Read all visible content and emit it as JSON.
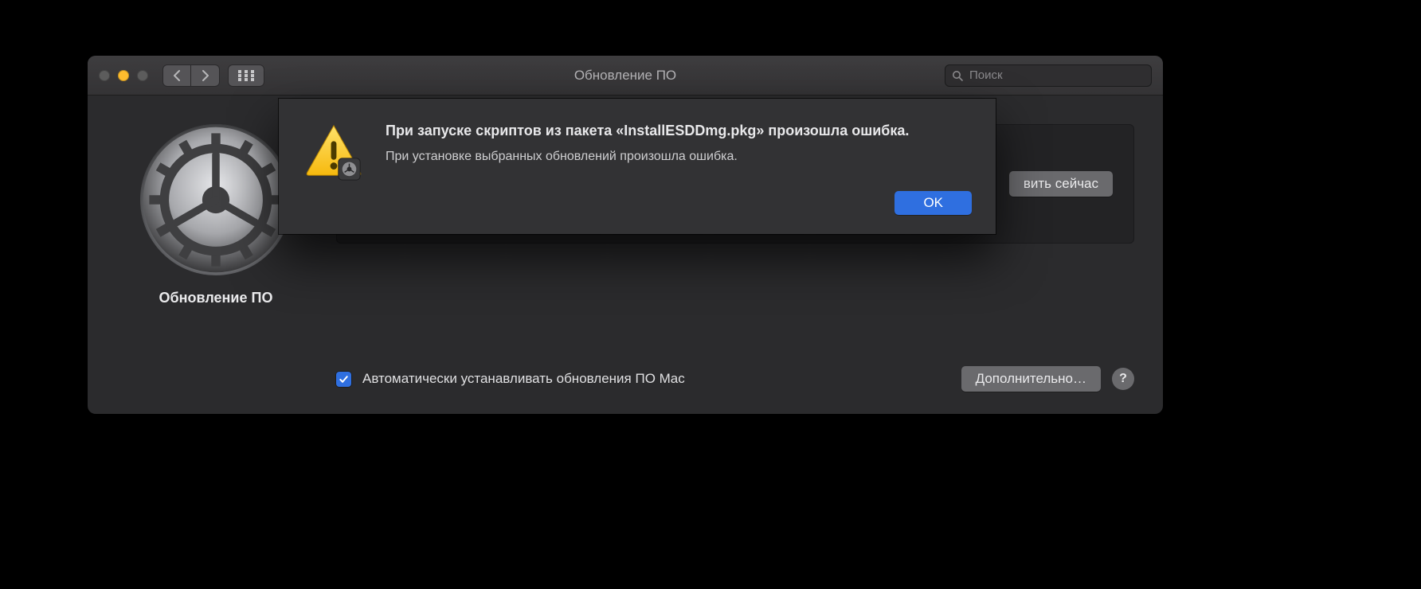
{
  "window": {
    "title": "Обновление ПО",
    "search_placeholder": "Поиск"
  },
  "left": {
    "label": "Обновление ПО"
  },
  "main": {
    "update_now": "вить сейчас",
    "auto_update_label": "Автоматически устанавливать обновления ПО Mac",
    "advanced": "Дополнительно…",
    "help": "?"
  },
  "alert": {
    "title": "При запуске скриптов из пакета «InstallESDDmg.pkg» произошла ошибка.",
    "message": "При установке выбранных обновлений произошла ошибка.",
    "ok": "OK"
  }
}
